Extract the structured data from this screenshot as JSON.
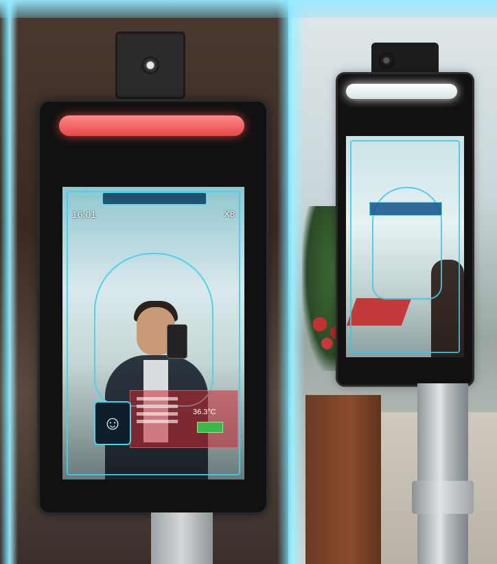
{
  "left_device": {
    "banner_text": "",
    "clock": "16:01",
    "model": "X8",
    "temperature": "36.3°C",
    "pass_label": "",
    "led_color": "#e84848"
  },
  "right_device": {
    "led_color": "#ffffff"
  },
  "accent_color": "#46d6f0",
  "icons": [
    "camera-icon",
    "face-avatar-icon"
  ]
}
